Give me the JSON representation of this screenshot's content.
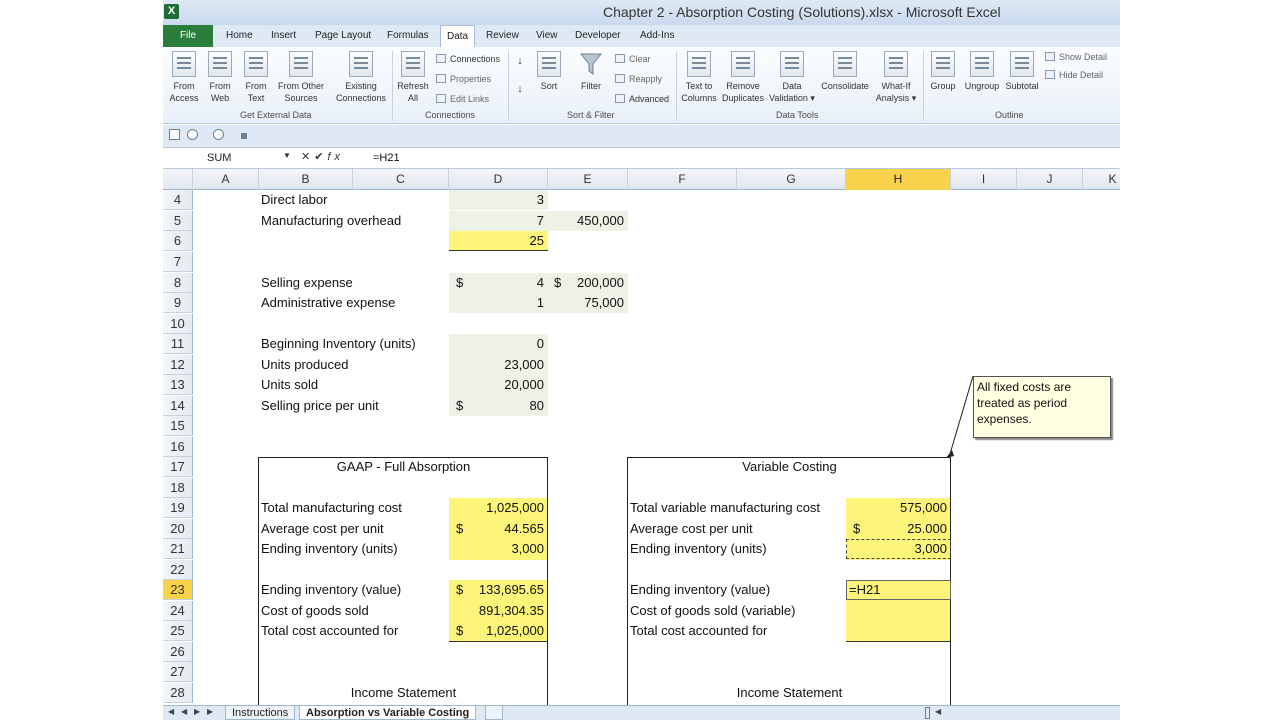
{
  "window": {
    "title": "Chapter 2 - Absorption Costing (Solutions).xlsx - Microsoft Excel"
  },
  "menu": {
    "file": "File",
    "tabs": [
      "Home",
      "Insert",
      "Page Layout",
      "Formulas",
      "Data",
      "Review",
      "View",
      "Developer",
      "Add-Ins"
    ],
    "active": "Data"
  },
  "ribbon": {
    "external": {
      "from_access": [
        "From",
        "Access"
      ],
      "from_web": [
        "From",
        "Web"
      ],
      "from_text": [
        "From",
        "Text"
      ],
      "from_other": [
        "From Other",
        "Sources"
      ],
      "existing": [
        "Existing",
        "Connections"
      ],
      "label": "Get External Data"
    },
    "connections": {
      "refresh": [
        "Refresh",
        "All"
      ],
      "connections": "Connections",
      "properties": "Properties",
      "edit_links": "Edit Links",
      "label": "Connections"
    },
    "sort": {
      "sort": "Sort",
      "filter": "Filter",
      "clear": "Clear",
      "reapply": "Reapply",
      "advanced": "Advanced",
      "label": "Sort & Filter"
    },
    "tools": {
      "text_to_columns": [
        "Text to",
        "Columns"
      ],
      "remove_dup": [
        "Remove",
        "Duplicates"
      ],
      "data_validation": [
        "Data",
        "Validation"
      ],
      "consolidate": "Consolidate",
      "what_if": [
        "What-If",
        "Analysis"
      ],
      "label": "Data Tools"
    },
    "outline": {
      "group": "Group",
      "ungroup": "Ungroup",
      "subtotal": "Subtotal",
      "show_detail": "Show Detail",
      "hide_detail": "Hide Detail",
      "label": "Outline"
    }
  },
  "formula_bar": {
    "name_box": "SUM",
    "formula": "=H21"
  },
  "columns": [
    "A",
    "B",
    "C",
    "D",
    "E",
    "F",
    "G",
    "H",
    "I",
    "J",
    "K"
  ],
  "selected_column": "H",
  "selected_row": "23",
  "rows": [
    "4",
    "5",
    "6",
    "7",
    "8",
    "9",
    "10",
    "11",
    "12",
    "13",
    "14",
    "15",
    "16",
    "17",
    "18",
    "19",
    "20",
    "21",
    "22",
    "23",
    "24",
    "25",
    "26",
    "27",
    "28"
  ],
  "cells": {
    "b4": "Direct labor",
    "d4": "3",
    "b5": "Manufacturing overhead",
    "d5": "7",
    "e5": "450,000",
    "d6": "25",
    "b8": "Selling expense",
    "d8_cur": "$",
    "d8": "4",
    "e8_cur": "$",
    "e8": "200,000",
    "b9": "Administrative expense",
    "d9": "1",
    "e9": "75,000",
    "b11": "Beginning Inventory (units)",
    "d11": "0",
    "b12": "Units produced",
    "d12": "23,000",
    "b13": "Units sold",
    "d13": "20,000",
    "b14": "Selling price per unit",
    "d14_cur": "$",
    "d14": "80",
    "gaap_title": "GAAP - Full Absorption",
    "b19": "Total manufacturing cost",
    "d19": "1,025,000",
    "b20": "Average cost per unit",
    "d20_cur": "$",
    "d20": "44.565",
    "b21": "Ending inventory (units)",
    "d21": "3,000",
    "b23": "Ending inventory (value)",
    "d23_cur": "$",
    "d23": "133,695.65",
    "b24": "Cost of goods sold",
    "d24": "891,304.35",
    "b25": "Total cost accounted for",
    "d25_cur": "$",
    "d25": "1,025,000",
    "gaap_income": "Income Statement",
    "var_title": "Variable Costing",
    "f19": "Total variable manufacturing cost",
    "h19": "575,000",
    "f20": "Average cost per unit",
    "h20_cur": "$",
    "h20": "25.000",
    "f21": "Ending inventory (units)",
    "h21": "3,000",
    "f23": "Ending inventory (value)",
    "h23": "=H21",
    "f24": "Cost of goods sold (variable)",
    "f25": "Total cost accounted for",
    "var_income": "Income Statement"
  },
  "comment": "All fixed costs are treated as period expenses.",
  "sheets": [
    "Instructions",
    "Absorption vs Variable Costing"
  ],
  "active_sheet": "Absorption vs Variable Costing"
}
